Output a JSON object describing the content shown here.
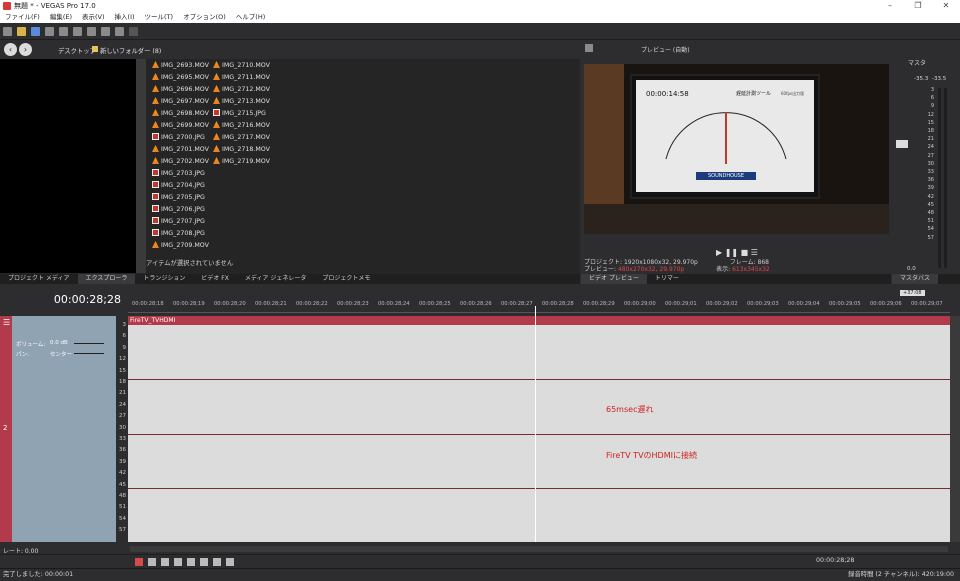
{
  "window": {
    "title": "無題 * - VEGAS Pro 17.0"
  },
  "menu": [
    "ファイル(F)",
    "編集(E)",
    "表示(V)",
    "挿入(I)",
    "ツール(T)",
    "オプション(O)",
    "ヘルプ(H)"
  ],
  "explorer": {
    "breadcrumb": [
      "デスクトップ",
      "新しいフォルダー (8)"
    ],
    "col1": [
      "IMG_2693.MOV",
      "IMG_2695.MOV",
      "IMG_2696.MOV",
      "IMG_2697.MOV",
      "IMG_2698.MOV",
      "IMG_2699.MOV",
      "IMG_2700.JPG",
      "IMG_2701.MOV",
      "IMG_2702.MOV",
      "IMG_2703.JPG",
      "IMG_2704.JPG",
      "IMG_2705.JPG",
      "IMG_2706.JPG",
      "IMG_2707.JPG",
      "IMG_2708.JPG",
      "IMG_2709.MOV"
    ],
    "col2": [
      "IMG_2710.MOV",
      "IMG_2711.MOV",
      "IMG_2712.MOV",
      "IMG_2713.MOV",
      "IMG_2715.JPG",
      "IMG_2716.MOV",
      "IMG_2717.MOV",
      "IMG_2718.MOV",
      "IMG_2719.MOV"
    ],
    "status": "アイテムが選択されていません"
  },
  "lower_tabs": [
    "プロジェクト メディア",
    "エクスプローラ",
    "トランジション",
    "ビデオ FX",
    "メディア ジェネレータ",
    "プロジェクトメモ"
  ],
  "preview": {
    "mode": "プレビュー (自動)",
    "overlay_time": "00:00:14:58",
    "overlay_title": "遅延計測ツール",
    "overlay_sub": "60fps出力版",
    "brand": "SOUNDHOUSE",
    "info": {
      "project_label": "プロジェクト:",
      "project": "1920x1080x32, 29.970p",
      "preview_label": "プレビュー:",
      "preview": "480x270x32, 29.970p",
      "frame_label": "フレーム:",
      "frame": "868",
      "display_label": "表示:",
      "display": "613x345x32"
    },
    "tabs": [
      "ビデオ プレビュー",
      "トリマー"
    ]
  },
  "master": {
    "label": "マスタ",
    "levels": [
      "-35.3",
      "-33.5"
    ],
    "scale": [
      "3",
      "6",
      "9",
      "12",
      "15",
      "18",
      "21",
      "24",
      "27",
      "30",
      "33",
      "36",
      "39",
      "42",
      "45",
      "48",
      "51",
      "54",
      "57"
    ],
    "tab": "マスタバス",
    "zero": "0.0",
    "badge": "+37:08"
  },
  "timeline": {
    "timecode": "00:00:28;28",
    "ruler": [
      "00:00:28;18",
      "00:00:28;19",
      "00:00:28;20",
      "00:00:28;21",
      "00:00:28;22",
      "00:00:28;23",
      "00:00:28;24",
      "00:00:28;25",
      "00:00:28;26",
      "00:00:28;27",
      "00:00:28;28",
      "00:00:28;29",
      "00:00:29;00",
      "00:00:29;01",
      "00:00:29;02",
      "00:00:29;03",
      "00:00:29;04",
      "00:00:29;05",
      "00:00:29;06",
      "00:00:29;07"
    ],
    "track": {
      "number": "2",
      "volume_label": "ボリューム:",
      "volume": "0.0 dB",
      "pan_label": "パン:",
      "pan": "センター",
      "clip": "FireTV_TVHDMI",
      "scale": [
        "3",
        "6",
        "9",
        "12",
        "15",
        "18",
        "21",
        "24",
        "27",
        "30",
        "33",
        "36",
        "39",
        "42",
        "45",
        "48",
        "51",
        "54",
        "57"
      ]
    },
    "annotations": [
      "65msec遅れ",
      "FireTV TVのHDMIに接続"
    ],
    "rate_label": "レート: 0.00",
    "cursor_time": "00:00:28;28"
  },
  "status": {
    "left": "完了しました: 00:00:01",
    "right": "録音時間 (2 チャンネル): 420:19:00"
  }
}
